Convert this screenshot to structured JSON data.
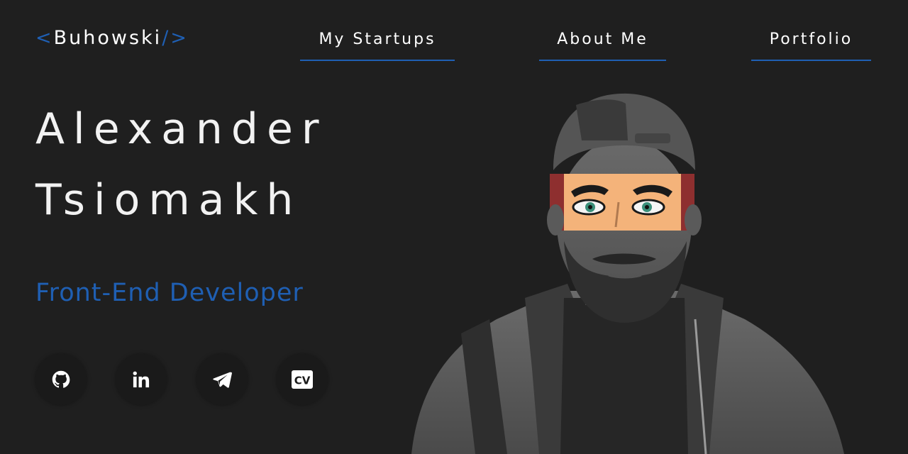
{
  "logo": {
    "open_bracket": "<",
    "name": "Buhowski",
    "close_bracket": "/>"
  },
  "nav": {
    "items": [
      {
        "label": "My Startups"
      },
      {
        "label": "About Me"
      },
      {
        "label": "Portfolio"
      }
    ]
  },
  "hero": {
    "first_name": "Alexander",
    "last_name": "Tsiomakh",
    "role": "Front-End Developer"
  },
  "social": {
    "items": [
      {
        "icon": "github-icon"
      },
      {
        "icon": "linkedin-icon"
      },
      {
        "icon": "telegram-icon"
      },
      {
        "icon": "cv-icon",
        "text": "CV"
      }
    ]
  },
  "colors": {
    "background": "#1f1f1f",
    "accent": "#1f5fb3",
    "text": "#ffffff",
    "button_bg": "#1a1a1a"
  }
}
